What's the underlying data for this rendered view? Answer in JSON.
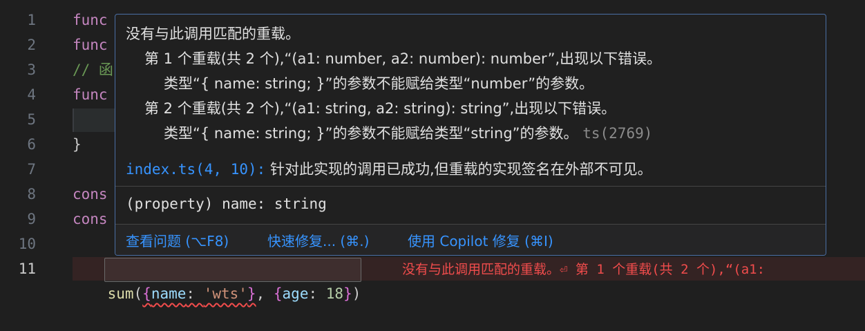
{
  "editor": {
    "line_numbers": [
      "1",
      "2",
      "3",
      "4",
      "5",
      "6",
      "7",
      "8",
      "9",
      "10",
      "11"
    ],
    "lines": {
      "l1": "func",
      "l2": "func",
      "l3_comment": "// 函",
      "l4": "func",
      "l6": "}",
      "l8": "cons",
      "l9": "cons",
      "l11": {
        "fn": "sum",
        "paren_open": "(",
        "brace_open": "{",
        "key": "name",
        "colon": ": ",
        "str_val": "'wts'",
        "brace_close": "}",
        "comma": ", ",
        "brace2_open": "{",
        "key2": "age",
        "colon2": ": ",
        "num_val": "18",
        "brace2_close": "}",
        "paren_close": ")"
      }
    },
    "inline_error": "没有与此调用匹配的重载。⏎ 第 1 个重载(共 2 个),“(a1:"
  },
  "hover": {
    "title": "没有与此调用匹配的重载。",
    "overload1": "第 1 个重载(共 2 个),“(a1: number, a2: number): number”,出现以下错误。",
    "overload1_detail": "类型“{ name: string; }”的参数不能赋给类型“number”的参数。",
    "overload2": "第 2 个重载(共 2 个),“(a1: string, a2: string): string”,出现以下错误。",
    "overload2_detail": "类型“{ name: string; }”的参数不能赋给类型“string”的参数。",
    "error_code": "ts(2769)",
    "related_link": "index.ts(4, 10):",
    "related_text": " 针对此实现的调用已成功,但重载的实现签名在外部不可见。",
    "signature": "(property) name: string",
    "actions": {
      "view_problem": "查看问题 (⌥F8)",
      "quick_fix": "快速修复... (⌘.)",
      "copilot_fix": "使用 Copilot 修复 (⌘I)"
    }
  },
  "colors": {
    "error": "#f14c4c",
    "link": "#3794ff",
    "popup_border": "#4a6fa5"
  }
}
